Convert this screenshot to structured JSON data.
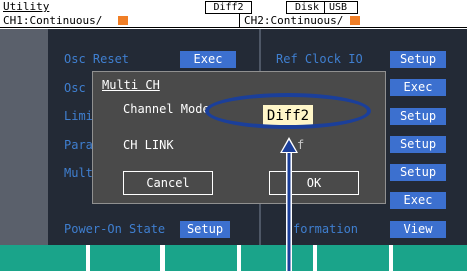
{
  "header": {
    "title": "Utility",
    "mode_badge": "Diff2",
    "disk_label": "Disk",
    "usb_label": "USB"
  },
  "channels": {
    "ch1": "CH1:Continuous/",
    "ch2": "CH2:Continuous/",
    "indicator_color": "#f07e26"
  },
  "menu": {
    "osc_reset": "Osc Reset",
    "osc_reset_button": "Exec",
    "row2": "Osc",
    "row3": "Limi",
    "row4": "Para",
    "row5": "Mult",
    "power_on_state": "Power-On State",
    "power_on_button": "Setup",
    "ref_clock_io": "Ref Clock IO",
    "ref_clock_button": "Setup",
    "right_buttons": [
      "Exec",
      "Setup",
      "Setup",
      "Setup",
      "Exec"
    ],
    "information": "formation",
    "information_button": "View"
  },
  "dialog": {
    "title": "Multi CH",
    "channel_mode_label": "Channel Mode",
    "channel_mode_value": "Diff2",
    "ch_link_label": "CH LINK",
    "ch_link_value": "f",
    "cancel_button": "Cancel",
    "ok_button": "OK"
  },
  "colors": {
    "background": "#232a36",
    "button": "#3c70cf",
    "dialog": "#4a4a4a",
    "softkey": "#1aa48a",
    "callout": "#1b3f9a",
    "value_highlight": "#fff6c8"
  }
}
